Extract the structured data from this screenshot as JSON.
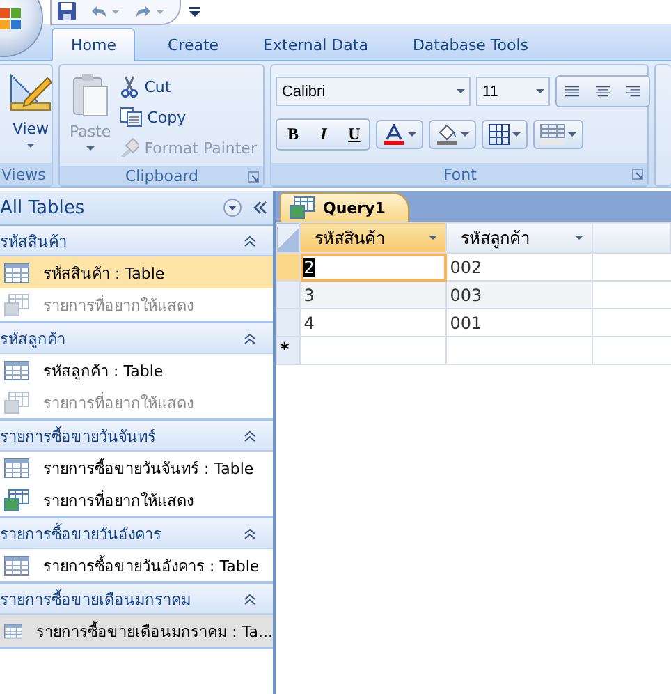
{
  "ribbon": {
    "tabs": [
      {
        "label": "Home",
        "selected": true
      },
      {
        "label": "Create",
        "selected": false
      },
      {
        "label": "External Data",
        "selected": false
      },
      {
        "label": "Database Tools",
        "selected": false
      }
    ],
    "views": {
      "button": "View",
      "label": "Views"
    },
    "clipboard": {
      "paste": "Paste",
      "cut": "Cut",
      "copy": "Copy",
      "format_painter": "Format Painter",
      "paste_disabled": true,
      "format_painter_disabled": true,
      "label": "Clipboard"
    },
    "font": {
      "font_name": "Calibri",
      "font_size": "11",
      "style_buttons": [
        "B",
        "I",
        "U"
      ],
      "label": "Font"
    }
  },
  "nav_pane": {
    "title": "All Tables",
    "groups": [
      {
        "title": "รหัสสินค้า",
        "expanded": true,
        "items": [
          {
            "kind": "table",
            "label": "รหัสสินค้า : Table",
            "selected": true,
            "hovered": false,
            "dimmed": false
          },
          {
            "kind": "query",
            "label": "รายการที่อยากให้แสดง",
            "selected": false,
            "hovered": false,
            "dimmed": true
          }
        ]
      },
      {
        "title": "รหัสลูกค้า",
        "expanded": true,
        "items": [
          {
            "kind": "table",
            "label": "รหัสลูกค้า : Table",
            "selected": false,
            "hovered": false,
            "dimmed": false
          },
          {
            "kind": "query",
            "label": "รายการที่อยากให้แสดง",
            "selected": false,
            "hovered": false,
            "dimmed": true
          }
        ]
      },
      {
        "title": "รายการซื้อขายวันจันทร์",
        "expanded": true,
        "items": [
          {
            "kind": "table",
            "label": "รายการซื้อขายวันจันทร์ : Table",
            "selected": false,
            "hovered": false,
            "dimmed": false
          },
          {
            "kind": "query",
            "label": "รายการที่อยากให้แสดง",
            "selected": false,
            "hovered": false,
            "dimmed": false
          }
        ]
      },
      {
        "title": "รายการซื้อขายวันอังคาร",
        "expanded": true,
        "items": [
          {
            "kind": "table",
            "label": "รายการซื้อขายวันอังคาร : Table",
            "selected": false,
            "hovered": false,
            "dimmed": false
          }
        ]
      },
      {
        "title": "รายการซื้อขายเดือนมกราคม",
        "expanded": true,
        "items": [
          {
            "kind": "table",
            "label": "รายการซื้อขายเดือนมกราคม : Ta...",
            "selected": false,
            "hovered": true,
            "dimmed": false
          }
        ]
      }
    ]
  },
  "document_tabs": [
    {
      "label": "Query1",
      "selected": true
    }
  ],
  "datasheet": {
    "columns": [
      {
        "label": "รหัสสินค้า",
        "selected": true
      },
      {
        "label": "รหัสลูกค้า",
        "selected": false
      }
    ],
    "rows": [
      {
        "cells": [
          "2",
          "002"
        ],
        "selected": true
      },
      {
        "cells": [
          "3",
          "003"
        ],
        "selected": false
      },
      {
        "cells": [
          "4",
          "001"
        ],
        "selected": false
      }
    ],
    "new_record_symbol": "*"
  }
}
